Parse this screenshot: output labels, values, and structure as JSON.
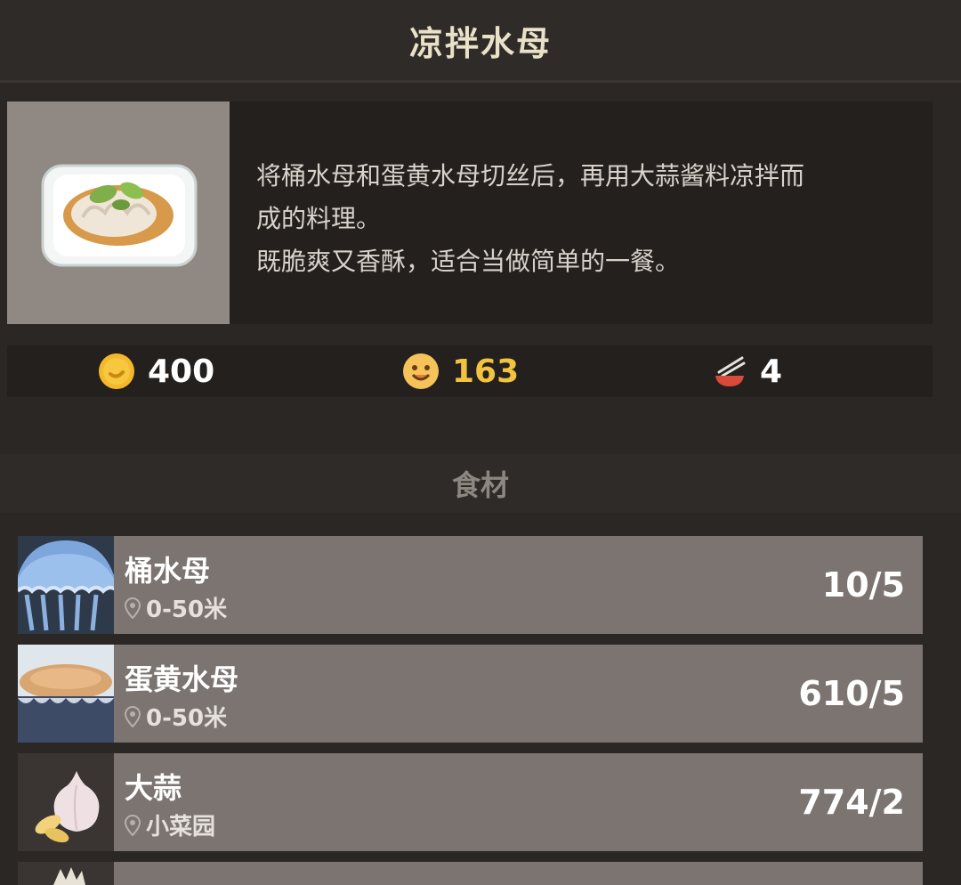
{
  "header": {
    "title": "凉拌水母"
  },
  "dish": {
    "icon": "jellyfish-salad-dish",
    "description_lines": [
      "将桶水母和蛋黄水母切丝后，再用大蒜酱料凉拌而",
      "成的料理。",
      "既脆爽又香酥，适合当做简单的一餐。"
    ]
  },
  "stats": {
    "price": {
      "icon": "coin-icon",
      "value": "400",
      "color": "#ffffff"
    },
    "taste": {
      "icon": "smiley-icon",
      "value": "163",
      "color": "#f2c33e"
    },
    "servings": {
      "icon": "chopsticks-bowl-icon",
      "value": "4",
      "color": "#ffffff"
    }
  },
  "ingredients_section": {
    "label": "食材"
  },
  "ingredients": [
    {
      "icon": "bucket-jellyfish",
      "name": "桶水母",
      "location": "0-50米",
      "count": "10/5"
    },
    {
      "icon": "egg-yolk-jellyfish",
      "name": "蛋黄水母",
      "location": "0-50米",
      "count": "610/5"
    },
    {
      "icon": "garlic",
      "name": "大蒜",
      "location": "小菜园",
      "count": "774/2"
    },
    {
      "icon": "partial-ingredient",
      "name": "",
      "location": "",
      "count": ""
    }
  ],
  "colors": {
    "background": "#2b2724",
    "panel": "#24201e",
    "row": "#7b7470",
    "accent_yellow": "#f2c33e"
  }
}
